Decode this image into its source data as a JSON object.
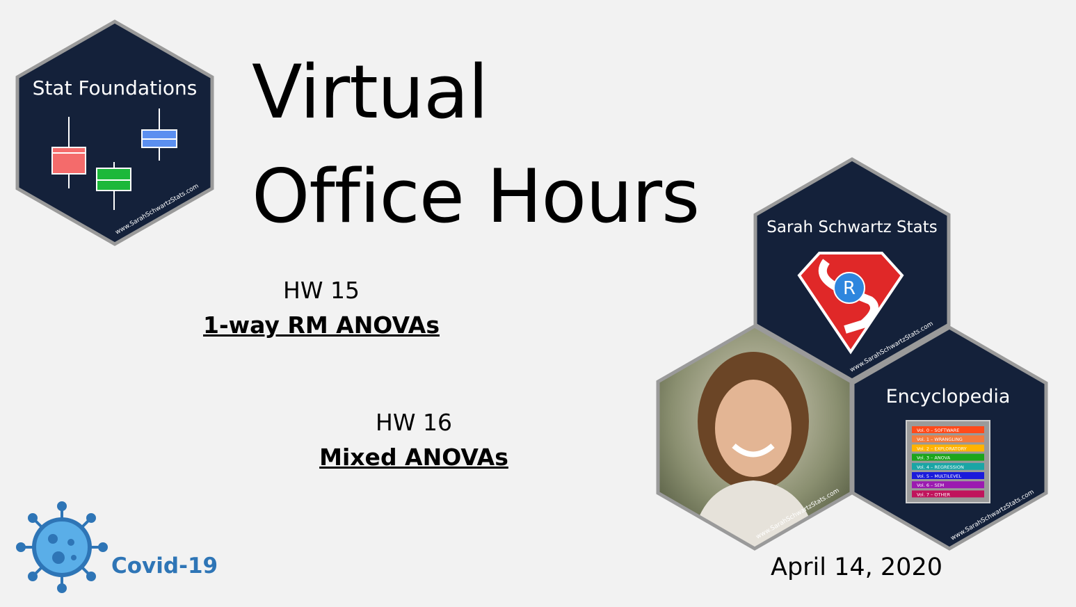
{
  "title": {
    "line1": "Virtual",
    "line2": "Office Hours"
  },
  "logos": {
    "stat_foundations": {
      "label": "Stat Foundations",
      "url": "www.SarahSchwartzStats.com"
    },
    "sss": {
      "label": "Sarah Schwartz Stats",
      "badge": "R",
      "url": "www.SarahSchwartzStats.com"
    },
    "photo": {
      "url": "www.SarahSchwartzStats.com"
    },
    "encyclopedia": {
      "label": "Encyclopedia",
      "url": "www.SarahSchwartzStats.com",
      "volumes": [
        {
          "text": "Vol. 0 – SOFTWARE",
          "color": "#ff4a1a"
        },
        {
          "text": "Vol. 1 – WRANGLING",
          "color": "#f47b3c"
        },
        {
          "text": "Vol. 2 – EXPLORATORY",
          "color": "#ffb300"
        },
        {
          "text": "Vol. 3 – ANOVA",
          "color": "#1ca51c"
        },
        {
          "text": "Vol. 4 – REGRESSION",
          "color": "#1aa5a5"
        },
        {
          "text": "Vol. 5 – MULTILEVEL",
          "color": "#1a1adb"
        },
        {
          "text": "Vol. 6 – SEM",
          "color": "#9b1ab0"
        },
        {
          "text": "Vol. 7 – OTHER",
          "color": "#c0145c"
        }
      ]
    }
  },
  "homework": [
    {
      "number": "HW 15",
      "topic": "1-way RM ANOVAs"
    },
    {
      "number": "HW 16",
      "topic": "Mixed ANOVAs"
    }
  ],
  "date": "April 14, 2020",
  "covid": {
    "label": "Covid-19"
  },
  "colors": {
    "hex_fill": "#14213a",
    "hex_border": "#9a9a9a",
    "covid_blue": "#2e75b6",
    "background": "#f2f2f2"
  }
}
